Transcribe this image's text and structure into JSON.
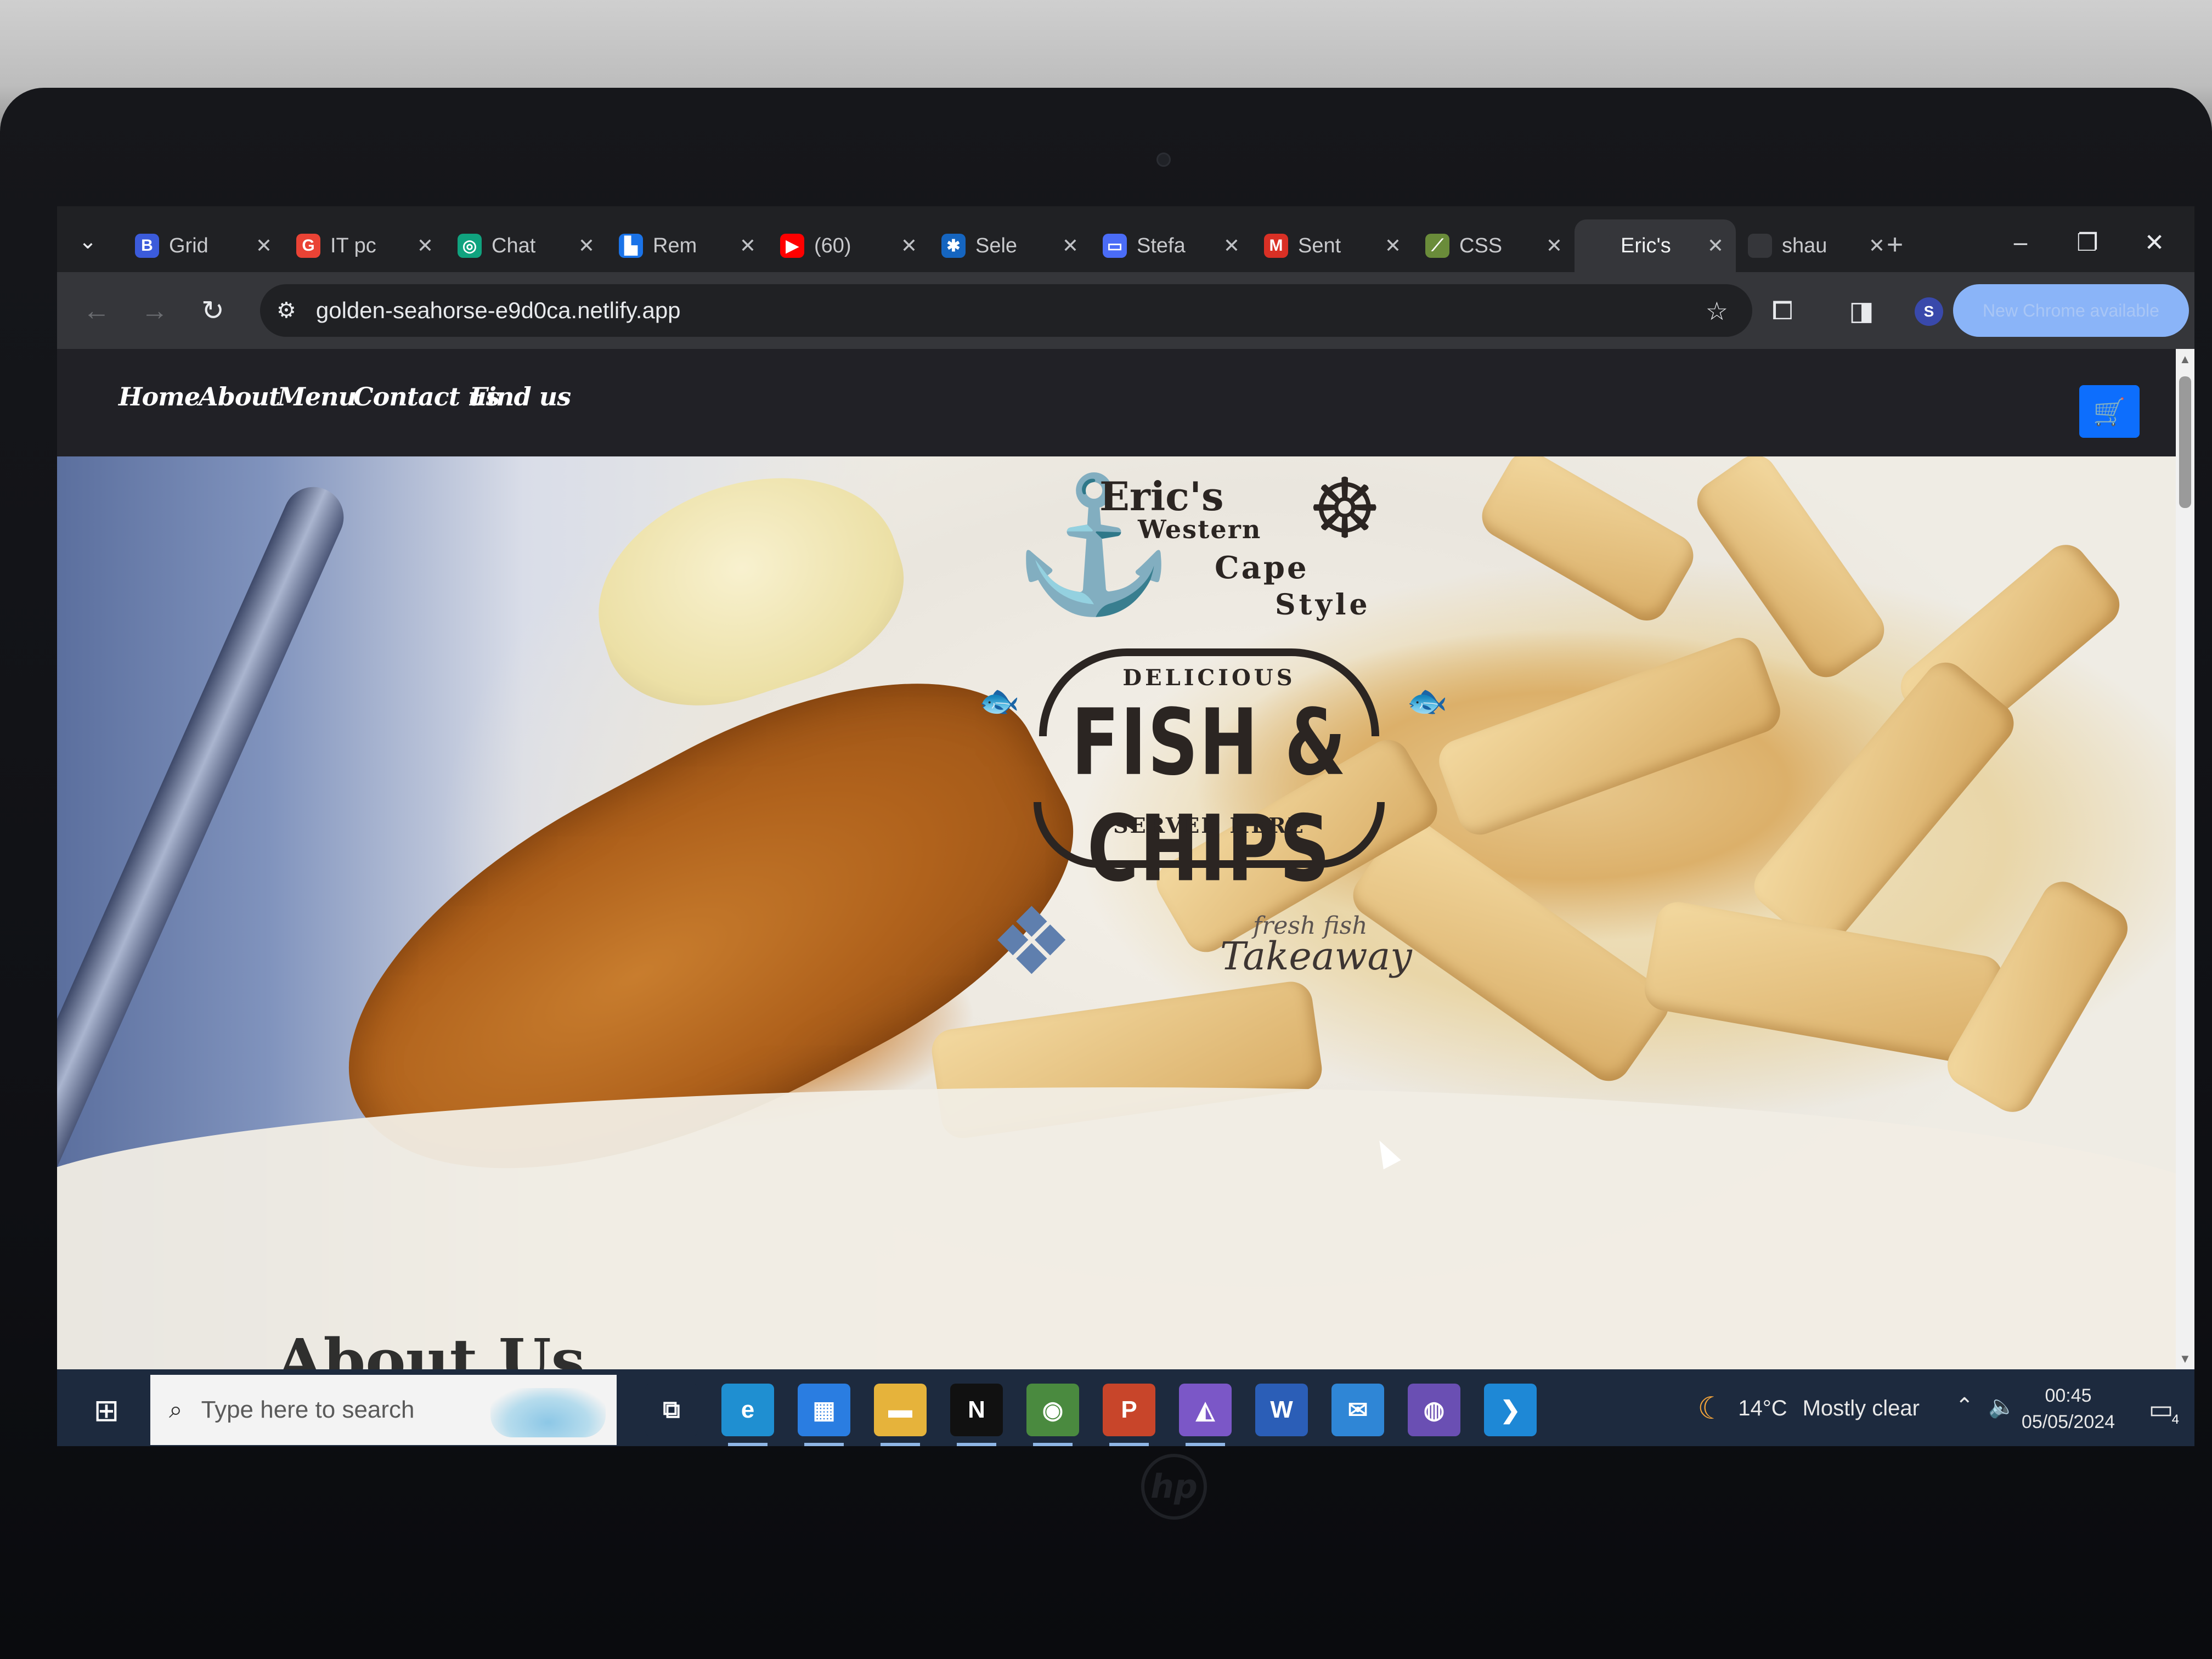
{
  "browser": {
    "tabs": [
      {
        "favicon": "B",
        "title": "Grid",
        "color": "#3b5bdb"
      },
      {
        "favicon": "G",
        "title": "IT pc",
        "color": "#ea4335"
      },
      {
        "favicon": "◎",
        "title": "Chat",
        "color": "#10a37f"
      },
      {
        "favicon": "▙",
        "title": "Rem",
        "color": "#1a73e8"
      },
      {
        "favicon": "▶",
        "title": "(60)",
        "color": "#ff0000"
      },
      {
        "favicon": "✱",
        "title": "Sele",
        "color": "#1565c0"
      },
      {
        "favicon": "▭",
        "title": "Stefa",
        "color": "#4a6cf7"
      },
      {
        "favicon": "M",
        "title": "Sent",
        "color": "#d93025"
      },
      {
        "favicon": "⟋",
        "title": "CSS",
        "color": "#6a8c3a"
      },
      {
        "favicon": "",
        "title": "Eric's",
        "color": "#35363a",
        "active": true
      },
      {
        "favicon": "",
        "title": "shau",
        "color": "#35363a"
      }
    ],
    "url": "golden-seahorse-e9d0ca.netlify.app",
    "profile_initial": "S",
    "update_label": "New Chrome available"
  },
  "site": {
    "nav": [
      "Home",
      "About",
      "Menu",
      "Contact us",
      "Find us"
    ],
    "logo": {
      "brand": "Eric's",
      "line2": "Western",
      "line3": "Cape",
      "line4": "Style",
      "delicious": "DELICIOUS",
      "main": "FISH & CHIPS",
      "served": "SERVED HERE",
      "fresh": "fresh fish",
      "takeaway": "Takeaway"
    },
    "section_peek": "About Us",
    "accent_color": "#0d6efd"
  },
  "taskbar": {
    "search_placeholder": "Type here to search",
    "weather_temp": "14°C",
    "weather_desc": "Mostly clear",
    "time": "00:45",
    "date": "05/05/2024",
    "notifications": "4",
    "apps": [
      {
        "name": "task-view",
        "glyph": "⧉",
        "color": "#1d2a3e"
      },
      {
        "name": "edge",
        "glyph": "e",
        "color": "#1f8fd1"
      },
      {
        "name": "store",
        "glyph": "▦",
        "color": "#2a7de1"
      },
      {
        "name": "file-explorer",
        "glyph": "▬",
        "color": "#e6b33b"
      },
      {
        "name": "netflix",
        "glyph": "N",
        "color": "#111111"
      },
      {
        "name": "chrome",
        "glyph": "◉",
        "color": "#4a8a3f"
      },
      {
        "name": "powerpoint",
        "glyph": "P",
        "color": "#c8452a"
      },
      {
        "name": "visual-studio",
        "glyph": "◭",
        "color": "#7b57c7"
      },
      {
        "name": "word",
        "glyph": "W",
        "color": "#2b5eb7"
      },
      {
        "name": "mail",
        "glyph": "✉",
        "color": "#2f86d6"
      },
      {
        "name": "github",
        "glyph": "◍",
        "color": "#6a4fb3"
      },
      {
        "name": "vscode",
        "glyph": "❯",
        "color": "#1e88d6"
      }
    ]
  }
}
